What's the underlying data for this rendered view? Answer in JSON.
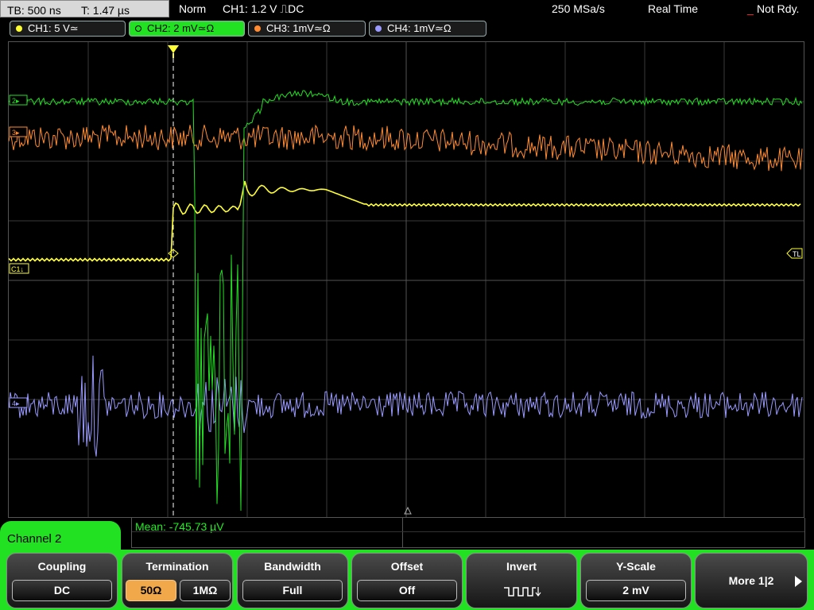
{
  "status": {
    "timebase": "TB: 500 ns",
    "trigger_time": "T: 1.47 µs",
    "mode": "Norm",
    "trigger": "CH1: 1.2 V ⎍DC",
    "sample_rate": "250 MSa/s",
    "acq_mode": "Real Time",
    "state": "Not Rdy."
  },
  "channels": [
    {
      "label": "CH1: 5 V≃",
      "color": "#ffff33"
    },
    {
      "label": "CH2: 2 mV≃Ω",
      "color": "#22e022"
    },
    {
      "label": "CH3: 1mV≃Ω",
      "color": "#ff8c33"
    },
    {
      "label": "CH4: 1mV≃Ω",
      "color": "#9a9aff"
    }
  ],
  "markers": {
    "ch2": "2▸",
    "ch3": "3▸",
    "ch1": "C1↓",
    "ch4": "4▸",
    "trigger_level": "TL"
  },
  "measurement": "Mean: -745.73 µV",
  "menu": {
    "title": "Channel 2",
    "coupling": {
      "title": "Coupling",
      "value": "DC"
    },
    "termination": {
      "title": "Termination",
      "options": [
        "50Ω",
        "1MΩ"
      ],
      "selected": "50Ω"
    },
    "bandwidth": {
      "title": "Bandwidth",
      "value": "Full"
    },
    "offset": {
      "title": "Offset",
      "value": "Off"
    },
    "invert": {
      "title": "Invert"
    },
    "yscale": {
      "title": "Y-Scale",
      "value": "2 mV"
    },
    "more": "More 1|2"
  }
}
